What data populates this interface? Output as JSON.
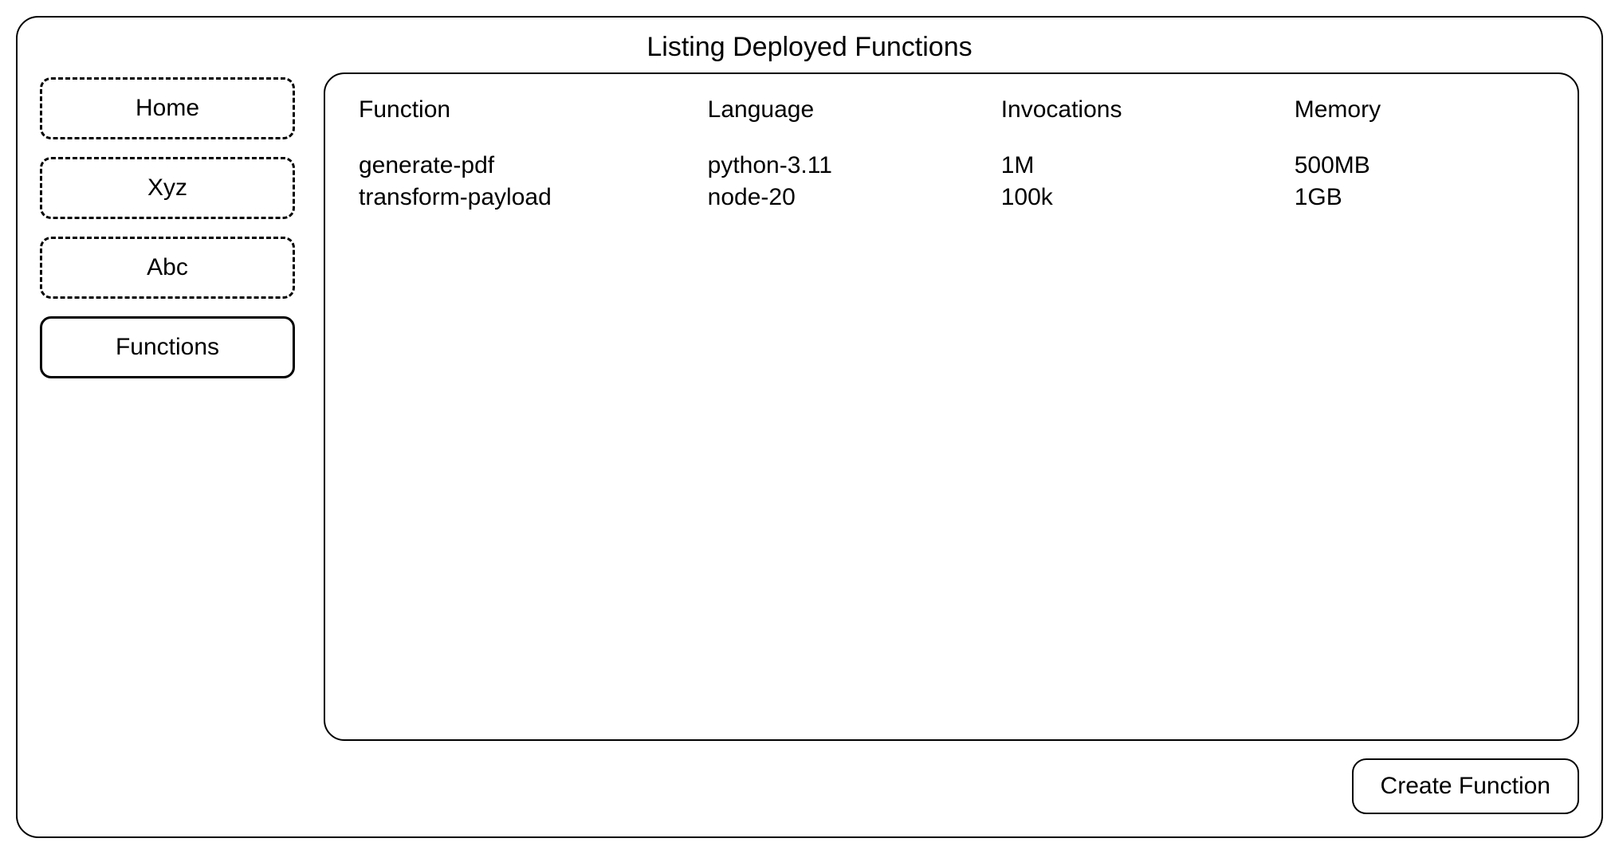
{
  "title": "Listing Deployed Functions",
  "sidebar": {
    "items": [
      {
        "label": "Home",
        "active": false
      },
      {
        "label": "Xyz",
        "active": false
      },
      {
        "label": "Abc",
        "active": false
      },
      {
        "label": "Functions",
        "active": true
      }
    ]
  },
  "table": {
    "headers": {
      "function": "Function",
      "language": "Language",
      "invocations": "Invocations",
      "memory": "Memory"
    },
    "rows": [
      {
        "function": "generate-pdf",
        "language": "python-3.11",
        "invocations": "1M",
        "memory": "500MB"
      },
      {
        "function": "transform-payload",
        "language": "node-20",
        "invocations": "100k",
        "memory": "1GB"
      }
    ]
  },
  "actions": {
    "create_label": "Create Function"
  }
}
